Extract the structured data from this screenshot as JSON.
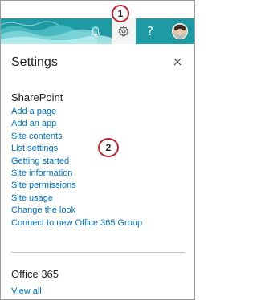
{
  "suite_bar": {
    "accent_color": "#1fa2a8",
    "selected_bg": "#f4f4f4",
    "bell_icon": "bell-icon",
    "gear_icon": "gear-icon",
    "help_label": "?",
    "avatar": "user-avatar"
  },
  "callouts": {
    "one": "1",
    "two": "2",
    "color": "#c0202a"
  },
  "settings": {
    "title": "Settings",
    "close_icon": "close-icon",
    "sharepoint": {
      "title": "SharePoint",
      "links": [
        "Add a page",
        "Add an app",
        "Site contents",
        "List settings",
        "Getting started",
        "Site information",
        "Site permissions",
        "Site usage",
        "Change the look",
        "Connect to new Office 365 Group"
      ]
    },
    "office365": {
      "title": "Office 365",
      "view_all": "View all"
    },
    "link_color": "#0072c6"
  }
}
